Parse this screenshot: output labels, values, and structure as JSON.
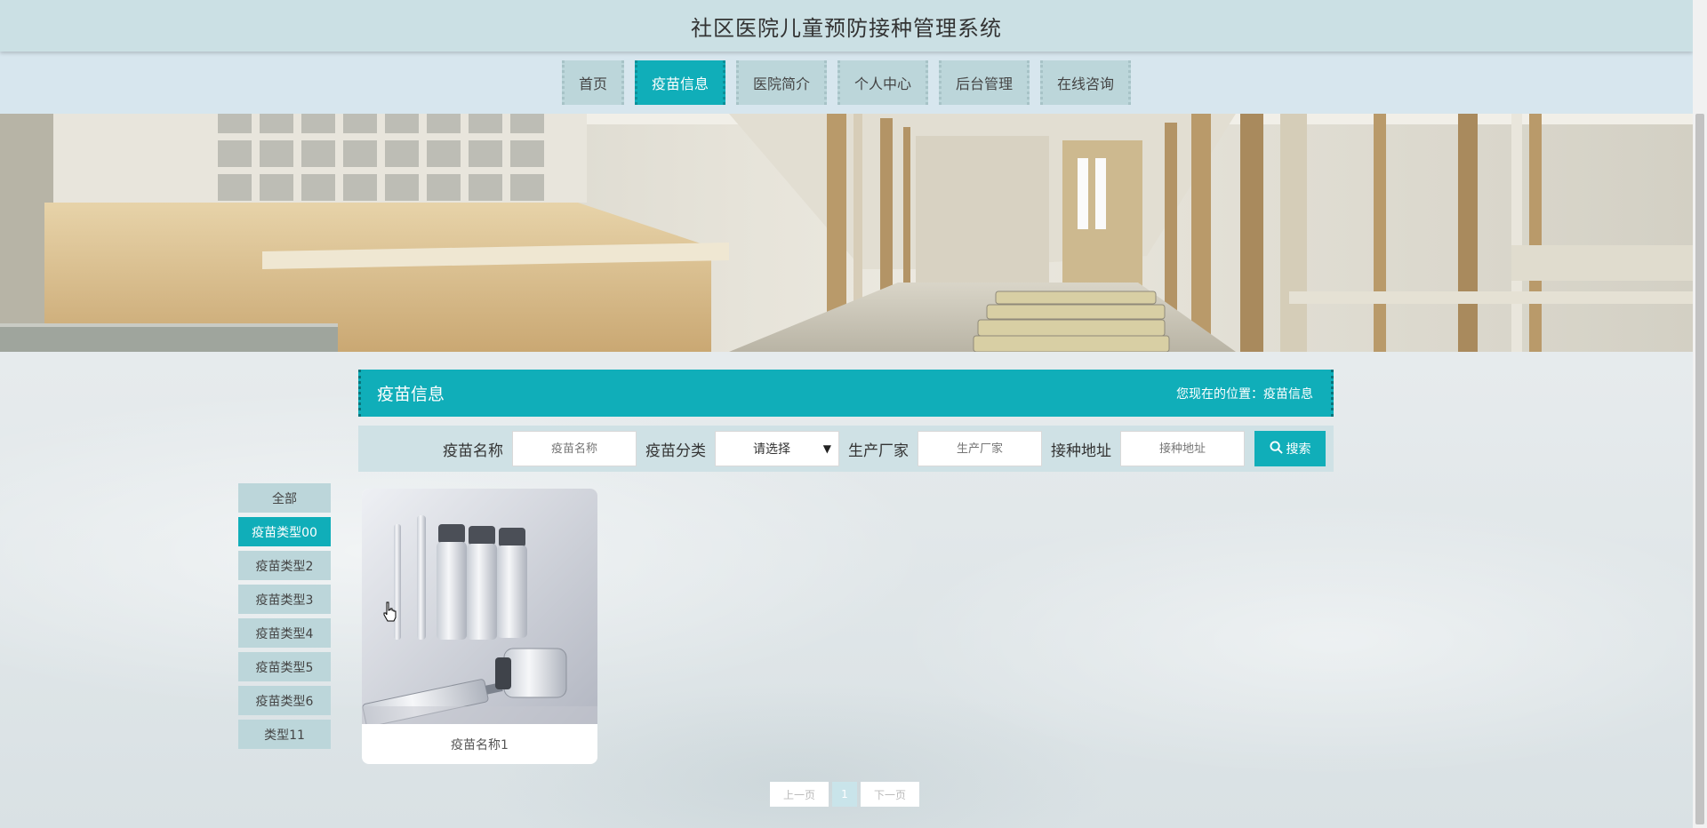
{
  "header": {
    "title": "社区医院儿童预防接种管理系统"
  },
  "nav": {
    "items": [
      {
        "label": "首页"
      },
      {
        "label": "疫苗信息",
        "active": true
      },
      {
        "label": "医院简介"
      },
      {
        "label": "个人中心"
      },
      {
        "label": "后台管理"
      },
      {
        "label": "在线咨询"
      }
    ]
  },
  "main": {
    "title": "疫苗信息",
    "breadcrumb": "您现在的位置：疫苗信息"
  },
  "search": {
    "name_label": "疫苗名称",
    "name_placeholder": "疫苗名称",
    "category_label": "疫苗分类",
    "category_selected": "请选择",
    "maker_label": "生产厂家",
    "maker_placeholder": "生产厂家",
    "address_label": "接种地址",
    "address_placeholder": "接种地址",
    "button_label": "搜索"
  },
  "sidebar": {
    "items": [
      {
        "label": "全部"
      },
      {
        "label": "疫苗类型00",
        "active": true
      },
      {
        "label": "疫苗类型2"
      },
      {
        "label": "疫苗类型3"
      },
      {
        "label": "疫苗类型4"
      },
      {
        "label": "疫苗类型5"
      },
      {
        "label": "疫苗类型6"
      },
      {
        "label": "类型11"
      }
    ]
  },
  "products": [
    {
      "name": "疫苗名称1"
    }
  ],
  "pagination": {
    "prev": "上一页",
    "current": "1",
    "next": "下一页"
  },
  "colors": {
    "accent": "#10aeb9",
    "nav_bg": "#bcd6da",
    "header_bg": "#cbe0e4"
  }
}
